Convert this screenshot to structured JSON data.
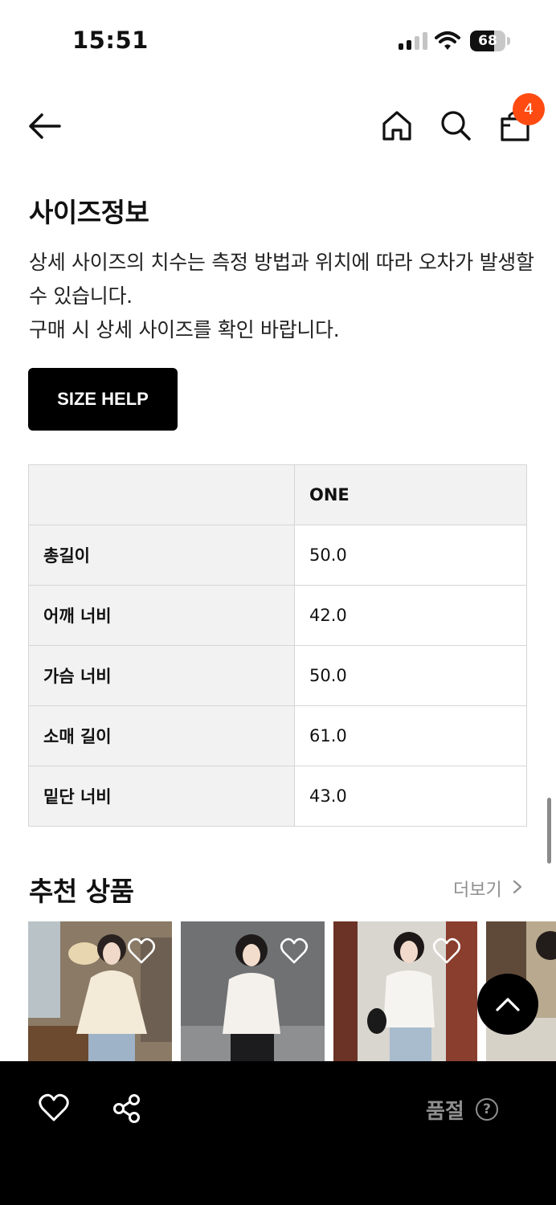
{
  "status_bar": {
    "time": "15:51",
    "battery": "68",
    "battery_level": 0.68
  },
  "header": {
    "cart_count": "4",
    "icons": [
      "back-arrow-icon",
      "home-icon",
      "search-icon",
      "shopping-bag-icon"
    ]
  },
  "size_info": {
    "title": "사이즈정보",
    "description_line1": "상세 사이즈의 치수는 측정 방법과 위치에 따라 오차가 발생할 수 있습니다.",
    "description_line2": "구매 시 상세 사이즈를 확인 바랍니다.",
    "help_button": "SIZE HELP",
    "table": {
      "header": [
        "",
        "ONE"
      ],
      "rows": [
        {
          "label": "총길이",
          "value": "50.0"
        },
        {
          "label": "어깨 너비",
          "value": "42.0"
        },
        {
          "label": "가슴 너비",
          "value": "50.0"
        },
        {
          "label": "소매 길이",
          "value": "61.0"
        },
        {
          "label": "밑단 너비",
          "value": "43.0"
        }
      ]
    }
  },
  "recommend": {
    "title": "추천 상품",
    "more_label": "더보기",
    "items": [
      {
        "image": "woman-cream-blouse-photo"
      },
      {
        "image": "woman-white-top-photo"
      },
      {
        "image": "woman-white-tshirt-brick-wall-photo"
      },
      {
        "image": "woman-outdoor-photo"
      }
    ]
  },
  "bottom_bar": {
    "sold_out_label": "품절",
    "help_glyph": "?"
  },
  "colors": {
    "accent_badge": "#ff4b12",
    "button_black": "#000000",
    "muted_text": "#8f8f8f",
    "table_header_bg": "#f2f2f2"
  }
}
